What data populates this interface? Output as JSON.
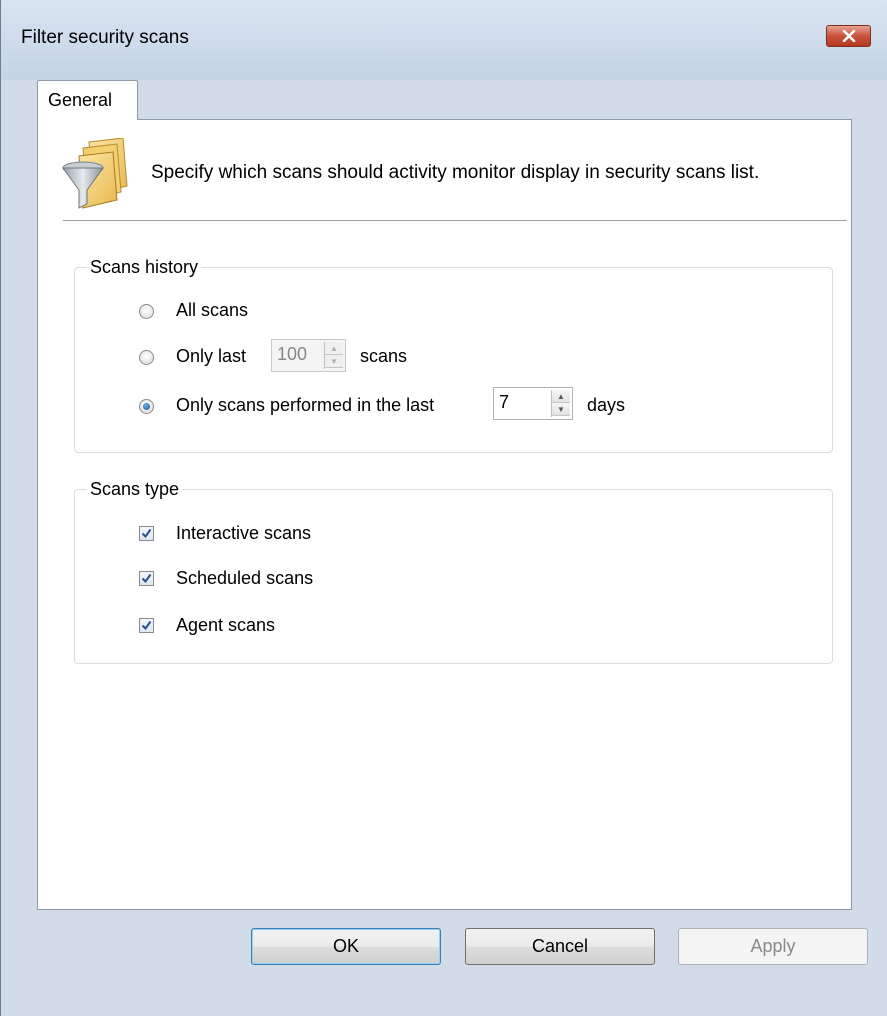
{
  "window": {
    "title": "Filter security scans",
    "close_icon": "close-x-icon"
  },
  "tabs": [
    {
      "label": "General",
      "selected": true
    }
  ],
  "header": {
    "icon": "filter-funnel-icon",
    "description": "Specify which scans should activity monitor display in security scans list."
  },
  "scans_history": {
    "title": "Scans history",
    "options": {
      "all": {
        "label": "All scans",
        "selected": false
      },
      "only_last": {
        "label_before": "Only last",
        "value": "100",
        "label_after": "scans",
        "selected": false,
        "enabled": false
      },
      "performed_last": {
        "label_before": "Only scans performed in the last",
        "value": "7",
        "label_after": "days",
        "selected": true,
        "enabled": true
      }
    }
  },
  "scans_type": {
    "title": "Scans type",
    "items": [
      {
        "label": "Interactive scans",
        "checked": true
      },
      {
        "label": "Scheduled scans",
        "checked": true
      },
      {
        "label": "Agent scans",
        "checked": true
      }
    ]
  },
  "buttons": {
    "ok": "OK",
    "cancel": "Cancel",
    "apply": "Apply",
    "apply_enabled": false
  },
  "colors": {
    "titlebar": "#c5d3e5",
    "close_button": "#c8533c",
    "default_button_border": "#3c7fb1"
  }
}
